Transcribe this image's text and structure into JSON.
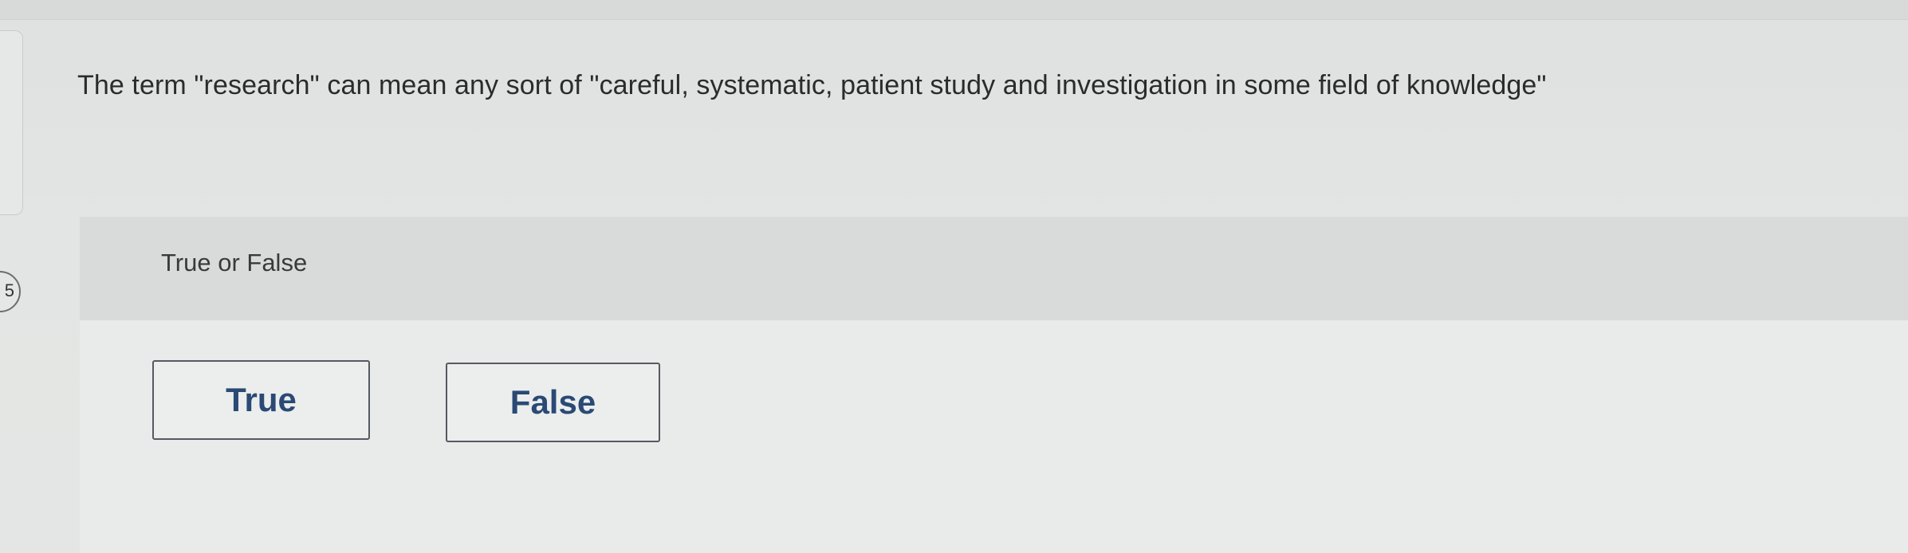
{
  "question": {
    "text": "The term \"research\" can mean any sort of \"careful, systematic, patient study and investigation in some field of knowledge\""
  },
  "answer_panel": {
    "prompt": "True or False",
    "options": [
      {
        "label": "True"
      },
      {
        "label": "False"
      }
    ]
  },
  "side_badge": {
    "text": "5"
  }
}
